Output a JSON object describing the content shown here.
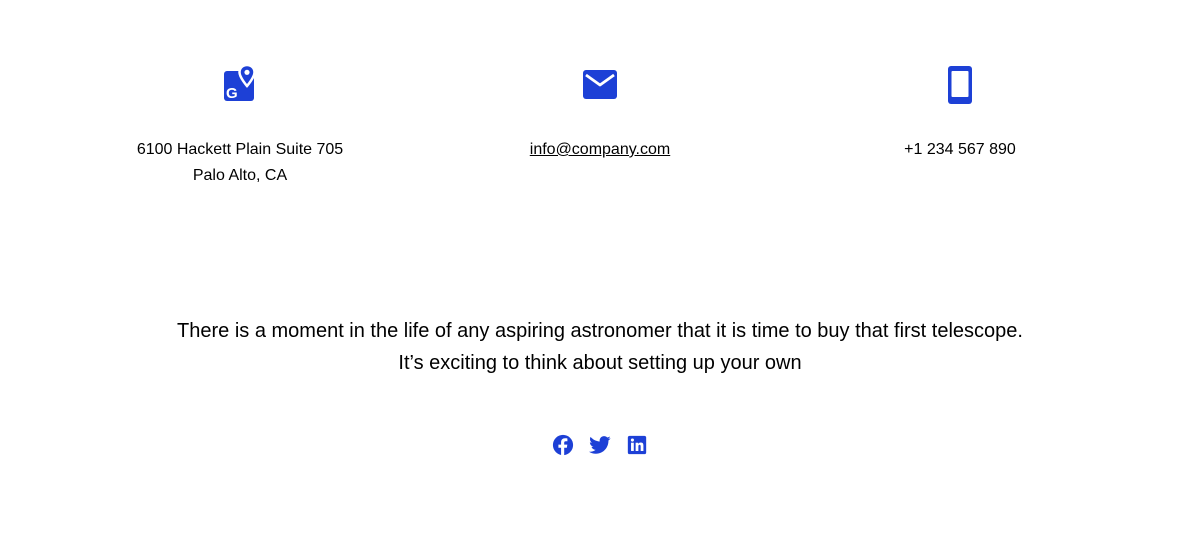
{
  "contacts": {
    "address": {
      "icon": "map-pin-icon",
      "line1": "6100 Hackett Plain Suite 705",
      "line2": "Palo Alto, CA"
    },
    "email": {
      "icon": "mail-icon",
      "label": "info@company.com"
    },
    "phone": {
      "icon": "smartphone-icon",
      "label": "+1 234 567 890"
    }
  },
  "tagline": {
    "line1": "There is a moment in the life of any aspiring astronomer that it is time to buy that first telescope.",
    "line2": "It’s exciting to think about setting up your own"
  },
  "social": [
    {
      "icon": "facebook-icon"
    },
    {
      "icon": "twitter-icon"
    },
    {
      "icon": "linkedin-icon"
    }
  ],
  "colors": {
    "accent": "#1d40d6",
    "text": "#000000",
    "background": "#ffffff"
  }
}
